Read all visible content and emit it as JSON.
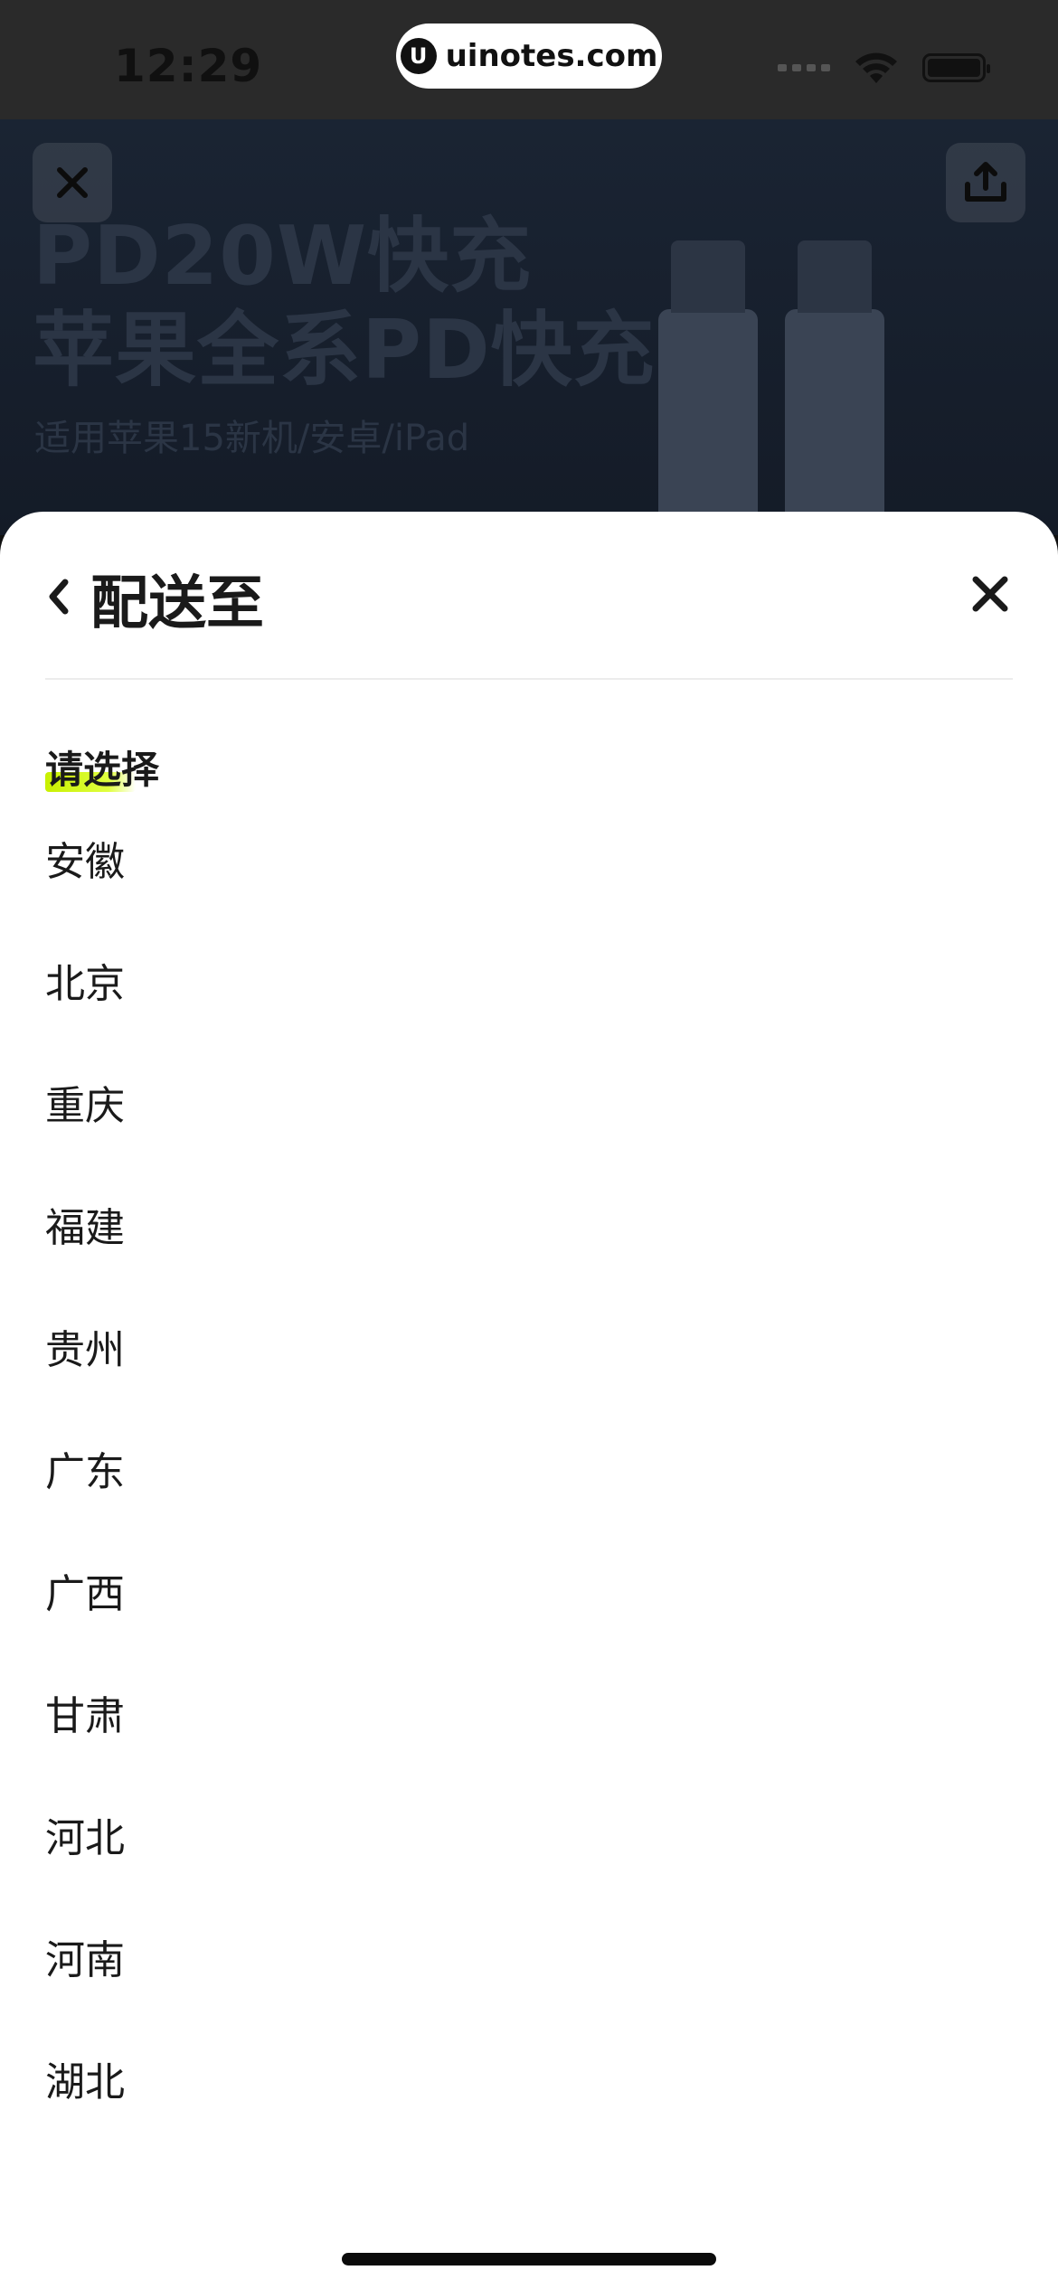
{
  "status_bar": {
    "time": "12:29",
    "watermark": "uinotes.com",
    "icons": [
      "cellular-signal-icon",
      "wifi-icon",
      "battery-icon"
    ]
  },
  "banner": {
    "headline_line1": "PD20W快充",
    "headline_line2": "苹果全系PD快充",
    "subtitle": "适用苹果15新机/安卓/iPad",
    "icons": [
      "close-icon",
      "share-icon"
    ]
  },
  "sheet": {
    "title": "配送至",
    "select_prompt": "请选择",
    "highlight_color": "#c8f000",
    "provinces": [
      "安徽",
      "北京",
      "重庆",
      "福建",
      "贵州",
      "广东",
      "广西",
      "甘肃",
      "河北",
      "河南",
      "湖北"
    ]
  }
}
